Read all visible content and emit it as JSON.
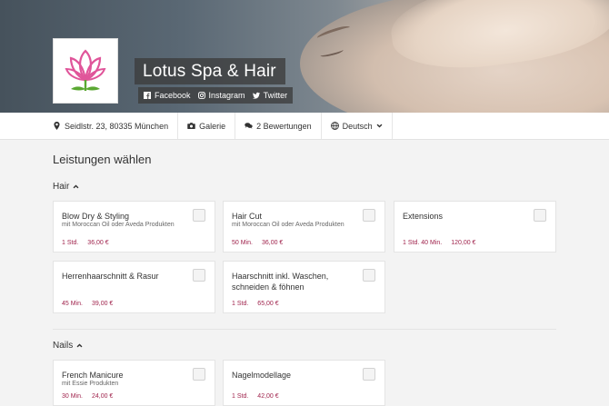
{
  "header": {
    "title": "Lotus Spa & Hair",
    "socials": [
      {
        "label": "Facebook",
        "icon": "facebook-icon"
      },
      {
        "label": "Instagram",
        "icon": "instagram-icon"
      },
      {
        "label": "Twitter",
        "icon": "twitter-icon"
      }
    ]
  },
  "infobar": {
    "address": "Seidlstr. 23, 80335 München",
    "gallery": "Galerie",
    "reviews": "2 Bewertungen",
    "language": "Deutsch"
  },
  "main": {
    "title": "Leistungen wählen",
    "categories": [
      {
        "name": "Hair",
        "services": [
          {
            "name": "Blow Dry & Styling",
            "sub": "mit Moroccan Oil oder Aveda Produkten",
            "duration": "1 Std.",
            "price": "36,00 €"
          },
          {
            "name": "Hair Cut",
            "sub": "mit Moroccan Oil oder Aveda Produkten",
            "duration": "50 Min.",
            "price": "36,00 €"
          },
          {
            "name": "Extensions",
            "sub": "",
            "duration": "1 Std. 40 Min.",
            "price": "120,00 €"
          },
          {
            "name": "Herrenhaarschnitt & Rasur",
            "sub": "",
            "duration": "45 Min.",
            "price": "39,00 €"
          },
          {
            "name": "Haarschnitt inkl. Waschen, schneiden & föhnen",
            "sub": "",
            "duration": "1 Std.",
            "price": "65,00 €"
          }
        ]
      },
      {
        "name": "Nails",
        "services": [
          {
            "name": "French Manicure",
            "sub": "mit Essie Produkten",
            "duration": "30 Min.",
            "price": "24,00 €"
          },
          {
            "name": "Nagelmodellage",
            "sub": "",
            "duration": "1 Std.",
            "price": "42,00 €"
          }
        ]
      }
    ]
  },
  "colors": {
    "accent": "#a0244d",
    "logo_pink": "#e0559a",
    "logo_green": "#5aa832"
  }
}
